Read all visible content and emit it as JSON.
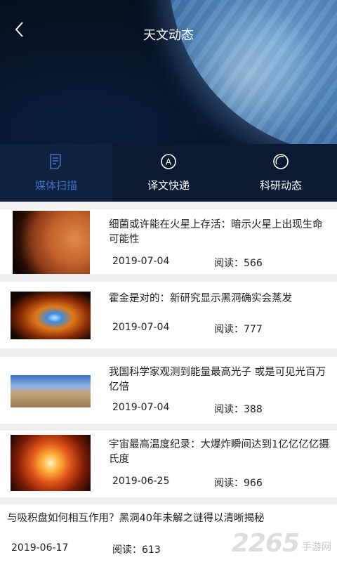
{
  "header": {
    "title": "天文动态",
    "back_icon": "back-arrow-icon"
  },
  "tabs": [
    {
      "label": "媒体扫描",
      "icon": "document-icon",
      "active": true
    },
    {
      "label": "译文快递",
      "icon": "circle-a-icon",
      "active": false
    },
    {
      "label": "科研动态",
      "icon": "ring-icon",
      "active": false
    }
  ],
  "articles": [
    {
      "title": "细菌或许能在火星上存活：暗示火星上出现生命可能性",
      "date": "2019-07-04",
      "reads": "阅读：566",
      "thumb": "mars"
    },
    {
      "title": "霍金是对的：新研究显示黑洞确实会蒸发",
      "date": "2019-07-04",
      "reads": "阅读：777",
      "thumb": "blackhole"
    },
    {
      "title": "我国科学家观测到能量最高光子 或是可见光百万亿倍",
      "date": "2019-07-04",
      "reads": "阅读：388",
      "thumb": "observatory"
    },
    {
      "title": "宇宙最高温度纪录：大爆炸瞬间达到1亿亿亿亿摄氏度",
      "date": "2019-06-25",
      "reads": "阅读：966",
      "thumb": "explosion"
    },
    {
      "title": "与吸积盘如何相互作用？黑洞40年未解之谜得以清晰揭秘",
      "date": "2019-06-17",
      "reads": "阅读：613",
      "thumb": ""
    }
  ],
  "watermark": {
    "number": "2265",
    "text": "手游网"
  }
}
